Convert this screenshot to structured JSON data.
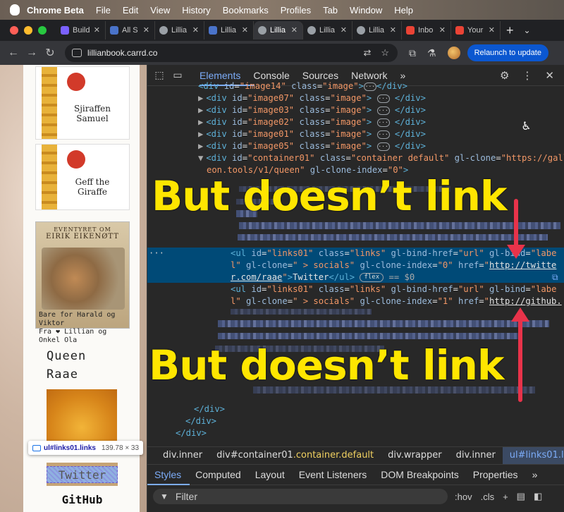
{
  "menubar": {
    "app": "Chrome Beta",
    "items": [
      "File",
      "Edit",
      "View",
      "History",
      "Bookmarks",
      "Profiles",
      "Tab",
      "Window",
      "Help"
    ]
  },
  "tabs": [
    {
      "label": "Build",
      "fav": "#7b61ff"
    },
    {
      "label": "All S",
      "fav": "#4a73c9"
    },
    {
      "label": "Lillia",
      "fav": "#9aa0a6"
    },
    {
      "label": "Lillia",
      "fav": "#4a73c9"
    },
    {
      "label": "Lillia",
      "fav": "#9aa0a6",
      "active": true
    },
    {
      "label": "Lillia",
      "fav": "#9aa0a6"
    },
    {
      "label": "Lillia",
      "fav": "#9aa0a6"
    },
    {
      "label": "Inbo",
      "fav": "#ea4335"
    },
    {
      "label": "Your",
      "fav": "#ea4335"
    }
  ],
  "address": {
    "url": "lillianbook.carrd.co",
    "relaunch": "Relaunch to update"
  },
  "page": {
    "book1": {
      "line1": "Sjiraffen",
      "line2": "Samuel"
    },
    "book2": {
      "line1": "Geff the",
      "line2": "Giraffe"
    },
    "book3": {
      "top": "EVENTYRET OM",
      "title": "EIRIK EIKENØTT",
      "cap1": "Bare for Harald og Viktor",
      "cap2": "Fra ❤ Lillian og Onkel Ola"
    },
    "heading1": "Queen",
    "heading2": "Raae",
    "twitter": "Twitter",
    "github": "GitHub",
    "tooltip": {
      "element": "ul",
      "selector": "#links01",
      "cls": ".links",
      "size": "139.78 × 33"
    }
  },
  "devtools": {
    "tabs": [
      "Elements",
      "Console",
      "Sources",
      "Network"
    ],
    "code": {
      "l1": {
        "id": "image14",
        "cls": "image"
      },
      "l2": {
        "id": "image07",
        "cls": "image"
      },
      "l3": {
        "id": "image03",
        "cls": "image"
      },
      "l4": {
        "id": "image02",
        "cls": "image"
      },
      "l5": {
        "id": "image01",
        "cls": "image"
      },
      "l6": {
        "id": "image05",
        "cls": "image"
      },
      "container": {
        "id": "container01",
        "cls": "container default",
        "clone_a": "https://gall",
        "clone_b": "eon.tools/v1/queen",
        "index": "0"
      },
      "ul1": {
        "id": "links01",
        "cls": "links",
        "bind_href": "url",
        "bind_a": "labe",
        "bind_b": "l",
        "clone": " > socials",
        "index": "0",
        "href_a": "http://twitte",
        "href_b": "r.com/raae",
        "text": "Twitter",
        "badge": "flex",
        "eq": "== $0"
      },
      "ul2": {
        "id": "links01",
        "cls": "links",
        "bind_href": "url",
        "bind_a": "labe",
        "bind_b": "l",
        "clone": " > socials",
        "index": "1",
        "href_a": "http://github."
      }
    },
    "annotation1": "But doesn’t link",
    "annotation2": "But doesn’t link",
    "crumbs": [
      {
        "id": "div",
        "cls": ".inner"
      },
      {
        "id": "div#container01",
        "cls": ".container.default"
      },
      {
        "id": "div",
        "cls": ".wrapper"
      },
      {
        "id": "div",
        "cls": ".inner"
      },
      {
        "id": "ul#links01",
        "cls": ".links",
        "active": true
      }
    ],
    "subtabs": [
      "Styles",
      "Computed",
      "Layout",
      "Event Listeners",
      "DOM Breakpoints",
      "Properties"
    ],
    "filter": {
      "placeholder": "Filter",
      "hov": ":hov",
      "cls": ".cls"
    }
  }
}
